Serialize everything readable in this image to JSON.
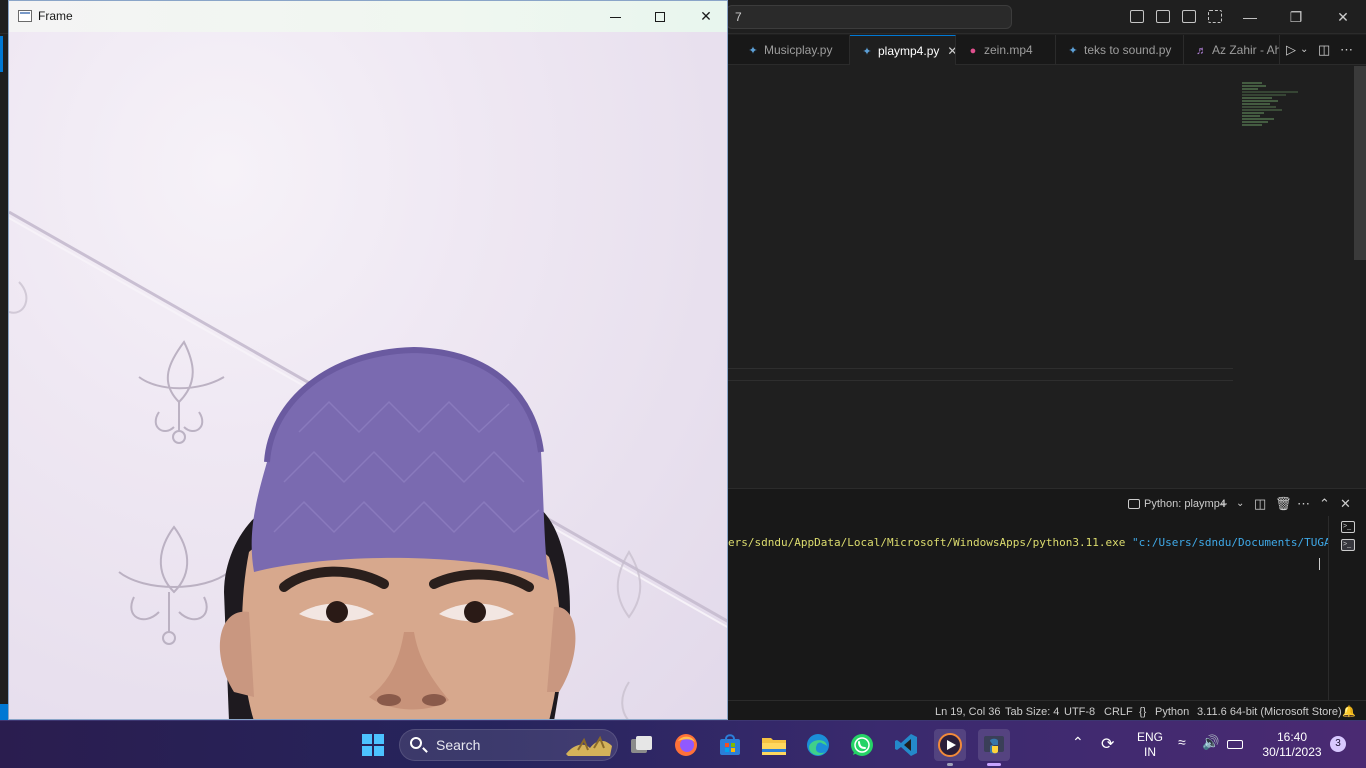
{
  "vscode": {
    "command_center_text": "7",
    "tabs": [
      {
        "label": "Musicplay.py",
        "icon": "python-file-icon",
        "active": false
      },
      {
        "label": "playmp4.py",
        "icon": "python-file-icon",
        "active": true
      },
      {
        "label": "zein.mp4",
        "icon": "video-file-icon",
        "active": false
      },
      {
        "label": "teks to sound.py",
        "icon": "python-file-icon",
        "active": false
      },
      {
        "label": "Az Zahir - Ahla",
        "icon": "audio-file-icon",
        "active": false
      }
    ],
    "tab_close_glyph": "✕",
    "terminal": {
      "tab_label": "Python: playmp4",
      "command_path": "ers/sdndu/AppData/Local/Microsoft/WindowsApps/python3.11.exe",
      "command_arg": "\"c:/Users/sdndu/Documents/TUGAS KAMP"
    },
    "statusbar": {
      "position": "Ln 19, Col 36",
      "tab_size": "Tab Size: 4",
      "encoding": "UTF-8",
      "eol": "CRLF",
      "language": "Python",
      "interpreter": "3.11.6 64-bit (Microsoft Store)"
    }
  },
  "frame_window": {
    "title": "Frame",
    "minimize_icon": "minimize-icon",
    "maximize_icon": "maximize-icon",
    "close_glyph": "✕"
  },
  "taskbar": {
    "search_label": "Search",
    "language_line1": "ENG",
    "language_line2": "IN",
    "time": "16:40",
    "date": "30/11/2023",
    "notification_count": "3",
    "apps": [
      "start-icon",
      "task-view-icon",
      "firefox-icon",
      "microsoft-store-icon",
      "file-explorer-icon",
      "edge-icon",
      "whatsapp-icon",
      "vscode-icon",
      "media-player-icon",
      "python-icon"
    ]
  },
  "colors": {
    "vscode_bg": "#1f1f1f",
    "accent_blue": "#0078d4",
    "terminal_yellow": "#dcdc6e",
    "terminal_blue": "#3fa9e8",
    "cap_purple": "#7a6ab0"
  }
}
